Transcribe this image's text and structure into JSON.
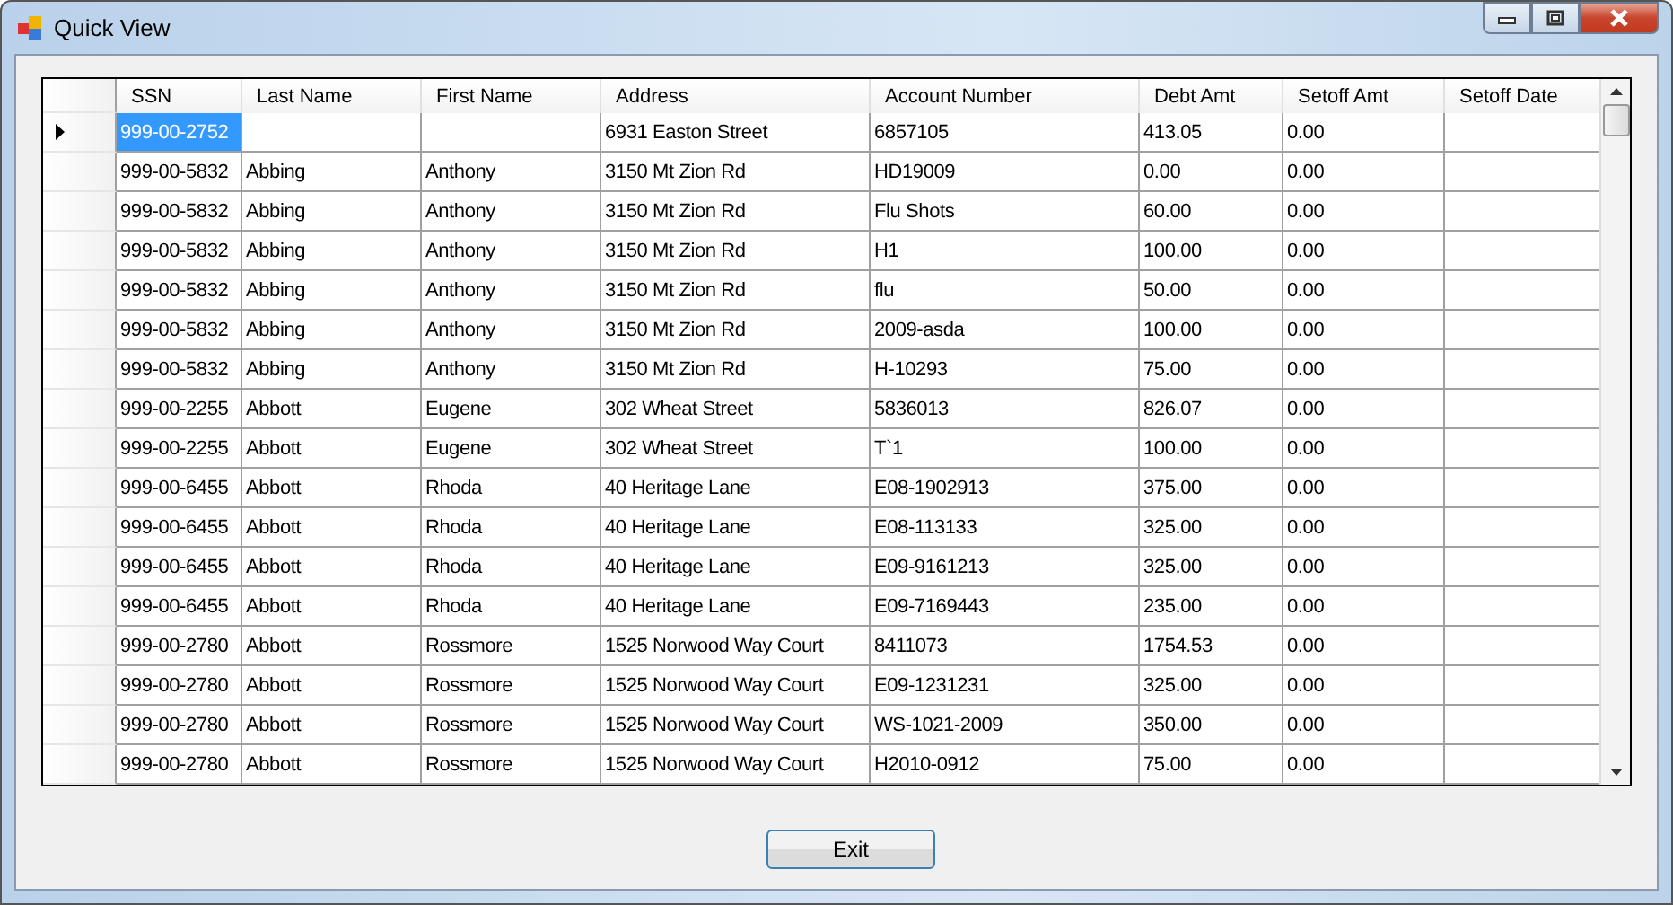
{
  "window": {
    "title": "Quick View"
  },
  "table": {
    "columns": [
      "SSN",
      "Last Name",
      "First Name",
      "Address",
      "Account Number",
      "Debt Amt",
      "Setoff Amt",
      "Setoff Date"
    ],
    "rows": [
      {
        "selected": true,
        "ssn": "999-00-2752",
        "address": "6931 Easton Street",
        "account_number": "6857105",
        "debt_amt": "413.05",
        "setoff_amt": "0.00"
      },
      {
        "selected": false,
        "ssn": "999-00-5832",
        "last_name": "Abbing",
        "first_name": "Anthony",
        "address": "3150 Mt Zion Rd",
        "account_number": "HD19009",
        "debt_amt": "0.00",
        "setoff_amt": "0.00"
      },
      {
        "selected": false,
        "ssn": "999-00-5832",
        "last_name": "Abbing",
        "first_name": "Anthony",
        "address": "3150 Mt Zion Rd",
        "account_number": "Flu Shots",
        "debt_amt": "60.00",
        "setoff_amt": "0.00"
      },
      {
        "selected": false,
        "ssn": "999-00-5832",
        "last_name": "Abbing",
        "first_name": "Anthony",
        "address": "3150 Mt Zion Rd",
        "account_number": "H1",
        "debt_amt": "100.00",
        "setoff_amt": "0.00"
      },
      {
        "selected": false,
        "ssn": "999-00-5832",
        "last_name": "Abbing",
        "first_name": "Anthony",
        "address": "3150 Mt Zion Rd",
        "account_number": "flu",
        "debt_amt": "50.00",
        "setoff_amt": "0.00"
      },
      {
        "selected": false,
        "ssn": "999-00-5832",
        "last_name": "Abbing",
        "first_name": "Anthony",
        "address": "3150 Mt Zion Rd",
        "account_number": "2009-asda",
        "debt_amt": "100.00",
        "setoff_amt": "0.00"
      },
      {
        "selected": false,
        "ssn": "999-00-5832",
        "last_name": "Abbing",
        "first_name": "Anthony",
        "address": "3150 Mt Zion Rd",
        "account_number": "H-10293",
        "debt_amt": "75.00",
        "setoff_amt": "0.00"
      },
      {
        "selected": false,
        "ssn": "999-00-2255",
        "last_name": "Abbott",
        "first_name": "Eugene",
        "address": "302 Wheat Street",
        "account_number": "5836013",
        "debt_amt": "826.07",
        "setoff_amt": "0.00"
      },
      {
        "selected": false,
        "ssn": "999-00-2255",
        "last_name": "Abbott",
        "first_name": "Eugene",
        "address": "302 Wheat Street",
        "account_number": "T`1",
        "debt_amt": "100.00",
        "setoff_amt": "0.00"
      },
      {
        "selected": false,
        "ssn": "999-00-6455",
        "last_name": "Abbott",
        "first_name": "Rhoda",
        "address": "40 Heritage Lane",
        "account_number": "E08-1902913",
        "debt_amt": "375.00",
        "setoff_amt": "0.00"
      },
      {
        "selected": false,
        "ssn": "999-00-6455",
        "last_name": "Abbott",
        "first_name": "Rhoda",
        "address": "40 Heritage Lane",
        "account_number": "E08-113133",
        "debt_amt": "325.00",
        "setoff_amt": "0.00"
      },
      {
        "selected": false,
        "ssn": "999-00-6455",
        "last_name": "Abbott",
        "first_name": "Rhoda",
        "address": "40 Heritage Lane",
        "account_number": "E09-9161213",
        "debt_amt": "325.00",
        "setoff_amt": "0.00"
      },
      {
        "selected": false,
        "ssn": "999-00-6455",
        "last_name": "Abbott",
        "first_name": "Rhoda",
        "address": "40 Heritage Lane",
        "account_number": "E09-7169443",
        "debt_amt": "235.00",
        "setoff_amt": "0.00"
      },
      {
        "selected": false,
        "ssn": "999-00-2780",
        "last_name": "Abbott",
        "first_name": "Rossmore",
        "address": "1525 Norwood Way Court",
        "account_number": "8411073",
        "debt_amt": "1754.53",
        "setoff_amt": "0.00"
      },
      {
        "selected": false,
        "ssn": "999-00-2780",
        "last_name": "Abbott",
        "first_name": "Rossmore",
        "address": "1525 Norwood Way Court",
        "account_number": "E09-1231231",
        "debt_amt": "325.00",
        "setoff_amt": "0.00"
      },
      {
        "selected": false,
        "ssn": "999-00-2780",
        "last_name": "Abbott",
        "first_name": "Rossmore",
        "address": "1525 Norwood Way Court",
        "account_number": "WS-1021-2009",
        "debt_amt": "350.00",
        "setoff_amt": "0.00"
      },
      {
        "selected": false,
        "ssn": "999-00-2780",
        "last_name": "Abbott",
        "first_name": "Rossmore",
        "address": "1525 Norwood Way Court",
        "account_number": "H2010-0912",
        "debt_amt": "75.00",
        "setoff_amt": "0.00"
      }
    ]
  },
  "buttons": [
    "Exit"
  ]
}
